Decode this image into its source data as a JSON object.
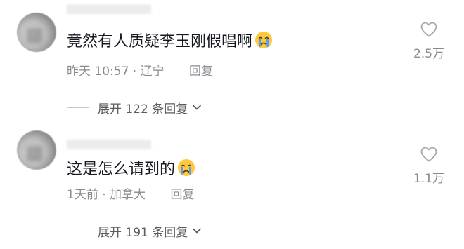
{
  "comments": [
    {
      "text": "竟然有人质疑李玉刚假唱啊",
      "emoji": "crying-face-emoji",
      "time_location": "昨天 10:57 · 辽宁",
      "reply_label": "回复",
      "expand_label": "展开 122 条回复",
      "likes": "2.5万"
    },
    {
      "text": "这是怎么请到的",
      "emoji": "crying-face-emoji",
      "time_location": "1天前 · 加拿大",
      "reply_label": "回复",
      "expand_label": "展开 191 条回复",
      "likes": "1.1万"
    }
  ]
}
